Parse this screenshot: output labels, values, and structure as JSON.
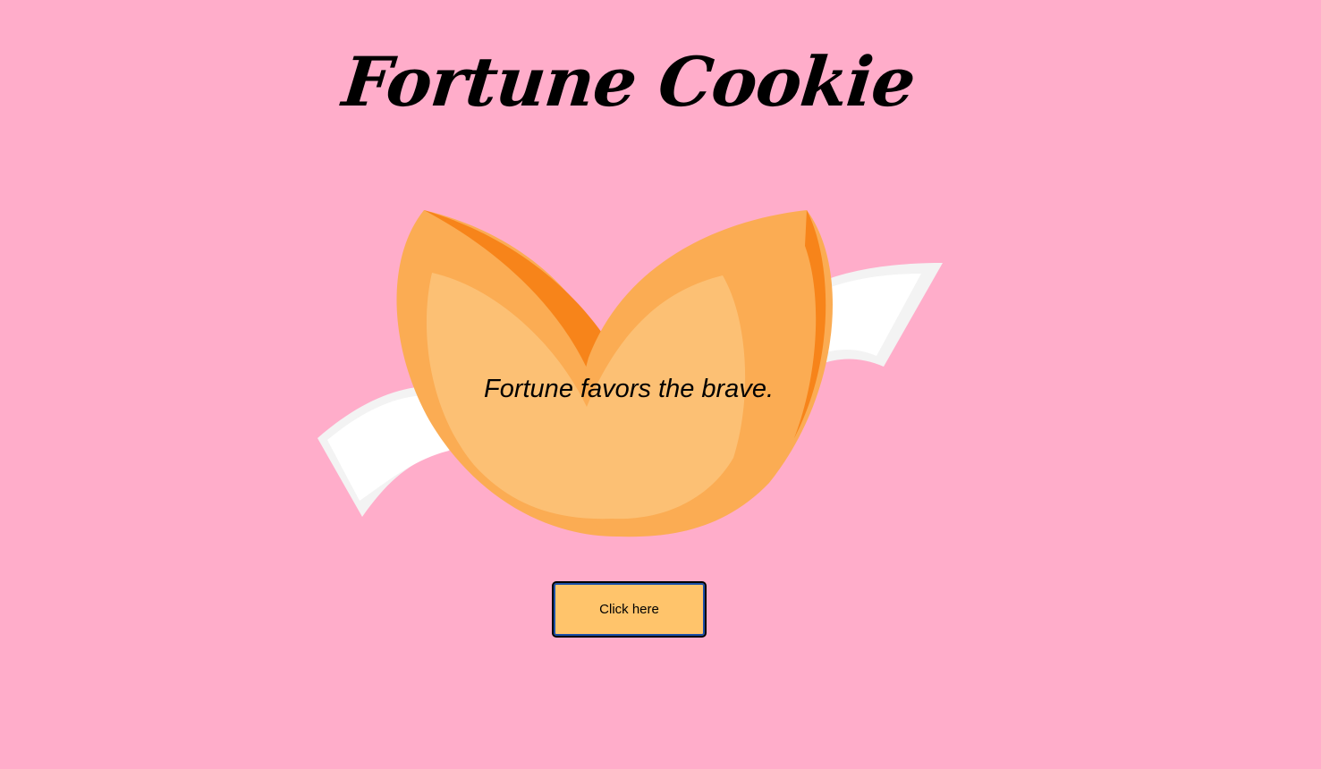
{
  "page": {
    "title": "Fortune Cookie",
    "background_color": "#ffadca"
  },
  "cookie": {
    "fortune": "Fortune favors the brave.",
    "colors": {
      "shell_outer": "#fbac53",
      "shell_inner": "#fcc074",
      "shell_dark": "#f7841a",
      "paper": "#ffffff",
      "paper_edge": "#f3f3f3"
    }
  },
  "actions": {
    "button_label": "Click here",
    "button_color": "#ffc46b"
  }
}
